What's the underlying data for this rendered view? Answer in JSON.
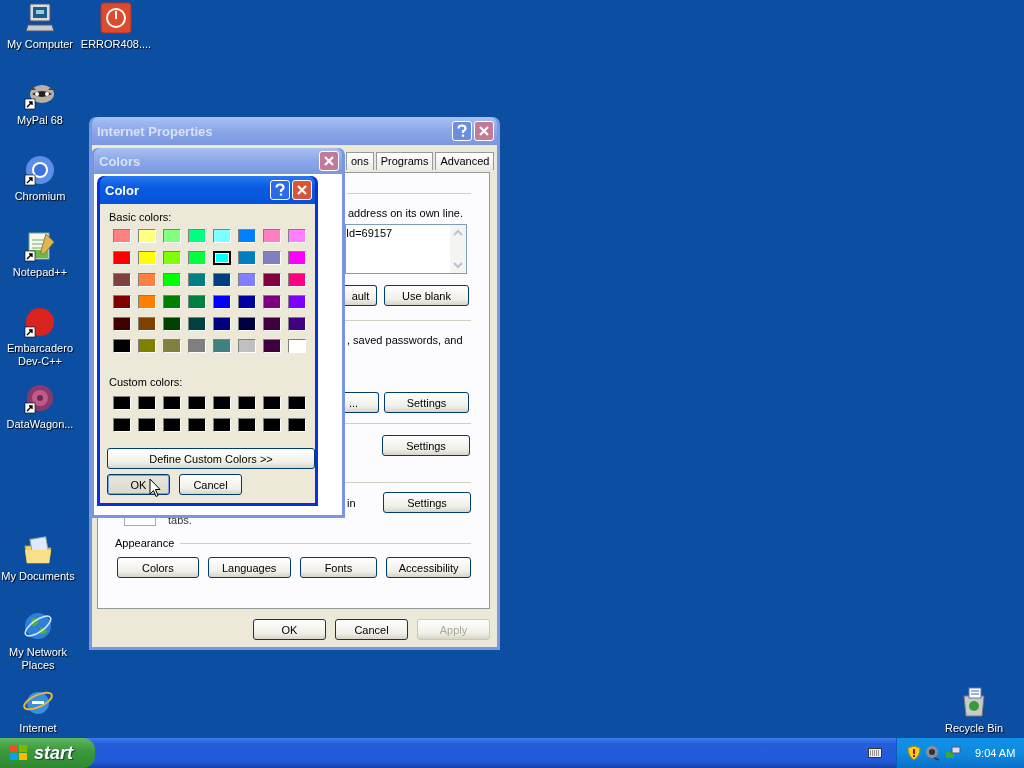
{
  "desktop_icons": [
    {
      "label": "My Computer",
      "kind": "computer"
    },
    {
      "label": "ERROR408....",
      "kind": "error"
    },
    {
      "label": "MyPal 68",
      "kind": "raccoon"
    },
    {
      "label": "Chromium",
      "kind": "chromium"
    },
    {
      "label": "Notepad++",
      "kind": "notepad"
    },
    {
      "label": "Embarcadero Dev-C++",
      "kind": "devcpp"
    },
    {
      "label": "DataWagon...",
      "kind": "datawagon"
    },
    {
      "label": "My Documents",
      "kind": "documents"
    },
    {
      "label": "My Network Places",
      "kind": "network"
    },
    {
      "label": "Internet",
      "kind": "ie"
    },
    {
      "label": "Recycle Bin",
      "kind": "recycle"
    }
  ],
  "internet_properties": {
    "title": "Internet Properties",
    "active": false,
    "tabs": [
      {
        "label": "ons",
        "selected": false
      },
      {
        "label": "Programs",
        "selected": false
      },
      {
        "label": "Advanced",
        "selected": false
      }
    ],
    "home_text": "address on its own line.",
    "home_value": "Id=69157",
    "home_buttons": [
      "ault",
      "Use blank"
    ],
    "history_text": ", saved passwords, and",
    "history_buttons": [
      "...",
      "Settings"
    ],
    "search_button": "Settings",
    "tabs_text": "in",
    "tabs_button": "Settings",
    "tabs_note": "tabs.",
    "appearance_label": "Appearance",
    "appearance_buttons": [
      "Colors",
      "Languages",
      "Fonts",
      "Accessibility"
    ],
    "footer_buttons": [
      {
        "label": "OK",
        "disabled": false
      },
      {
        "label": "Cancel",
        "disabled": false
      },
      {
        "label": "Apply",
        "disabled": true
      }
    ]
  },
  "colors_dialog": {
    "title": "Colors",
    "active": false
  },
  "color_dialog": {
    "title": "Color",
    "active": true,
    "basic_label": "Basic colors:",
    "basic_colors": [
      {
        "color": "#ff8080",
        "selected": false
      },
      {
        "color": "#ffff80",
        "selected": false
      },
      {
        "color": "#80ff80",
        "selected": false
      },
      {
        "color": "#00ff80",
        "selected": false
      },
      {
        "color": "#80ffff",
        "selected": false
      },
      {
        "color": "#0080ff",
        "selected": false
      },
      {
        "color": "#ff80c0",
        "selected": false
      },
      {
        "color": "#ff80ff",
        "selected": false
      },
      {
        "color": "#ff0000",
        "selected": false
      },
      {
        "color": "#ffff00",
        "selected": false
      },
      {
        "color": "#80ff00",
        "selected": false
      },
      {
        "color": "#00ff40",
        "selected": false
      },
      {
        "color": "#00ffff",
        "selected": true
      },
      {
        "color": "#0080c0",
        "selected": false
      },
      {
        "color": "#8080c0",
        "selected": false
      },
      {
        "color": "#ff00ff",
        "selected": false
      },
      {
        "color": "#804040",
        "selected": false
      },
      {
        "color": "#ff8040",
        "selected": false
      },
      {
        "color": "#00ff00",
        "selected": false
      },
      {
        "color": "#008080",
        "selected": false
      },
      {
        "color": "#004080",
        "selected": false
      },
      {
        "color": "#8080ff",
        "selected": false
      },
      {
        "color": "#800040",
        "selected": false
      },
      {
        "color": "#ff0080",
        "selected": false
      },
      {
        "color": "#800000",
        "selected": false
      },
      {
        "color": "#ff8000",
        "selected": false
      },
      {
        "color": "#008000",
        "selected": false
      },
      {
        "color": "#008040",
        "selected": false
      },
      {
        "color": "#0000ff",
        "selected": false
      },
      {
        "color": "#0000a0",
        "selected": false
      },
      {
        "color": "#800080",
        "selected": false
      },
      {
        "color": "#8000ff",
        "selected": false
      },
      {
        "color": "#400000",
        "selected": false
      },
      {
        "color": "#804000",
        "selected": false
      },
      {
        "color": "#004000",
        "selected": false
      },
      {
        "color": "#004040",
        "selected": false
      },
      {
        "color": "#000080",
        "selected": false
      },
      {
        "color": "#000040",
        "selected": false
      },
      {
        "color": "#400040",
        "selected": false
      },
      {
        "color": "#400080",
        "selected": false
      },
      {
        "color": "#000000",
        "selected": false
      },
      {
        "color": "#808000",
        "selected": false
      },
      {
        "color": "#808040",
        "selected": false
      },
      {
        "color": "#808080",
        "selected": false
      },
      {
        "color": "#408080",
        "selected": false
      },
      {
        "color": "#c0c0c0",
        "selected": false
      },
      {
        "color": "#400040",
        "selected": false
      },
      {
        "color": "#ffffff",
        "selected": false
      }
    ],
    "custom_label": "Custom colors:",
    "custom_colors": [
      {
        "color": "#000000"
      },
      {
        "color": "#000000"
      },
      {
        "color": "#000000"
      },
      {
        "color": "#000000"
      },
      {
        "color": "#000000"
      },
      {
        "color": "#000000"
      },
      {
        "color": "#000000"
      },
      {
        "color": "#000000"
      },
      {
        "color": "#000000"
      },
      {
        "color": "#000000"
      },
      {
        "color": "#000000"
      },
      {
        "color": "#000000"
      },
      {
        "color": "#000000"
      },
      {
        "color": "#000000"
      },
      {
        "color": "#000000"
      },
      {
        "color": "#000000"
      }
    ],
    "define_button": "Define Custom Colors >>",
    "buttons": [
      {
        "label": "OK",
        "focused": true
      },
      {
        "label": "Cancel",
        "focused": false
      }
    ]
  },
  "taskbar": {
    "start": "start",
    "time": "9:04 AM"
  }
}
